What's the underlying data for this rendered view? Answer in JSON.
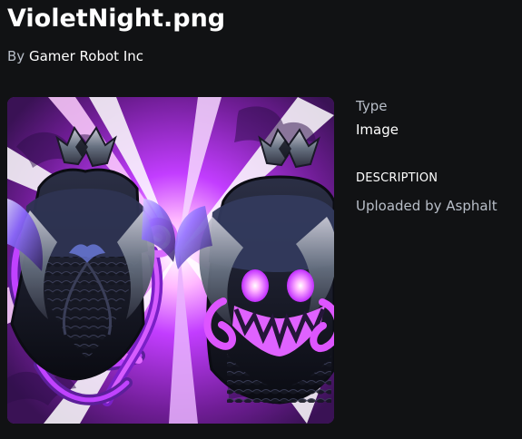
{
  "asset": {
    "title": "VioletNight.png",
    "creator_prefix": "By",
    "creator_name": "Gamer Robot Inc",
    "image_alt": "VioletNight artwork"
  },
  "details": {
    "type_label": "Type",
    "type_value": "Image",
    "description_heading": "DESCRIPTION",
    "description_text": "Uploaded by Asphalt"
  },
  "colors": {
    "background": "#111214",
    "accent_purple": "#b33cff",
    "dark_purple": "#5a1f87",
    "glow": "#ff7cff"
  },
  "icons": {
    "artwork": "violet-night-artwork"
  }
}
